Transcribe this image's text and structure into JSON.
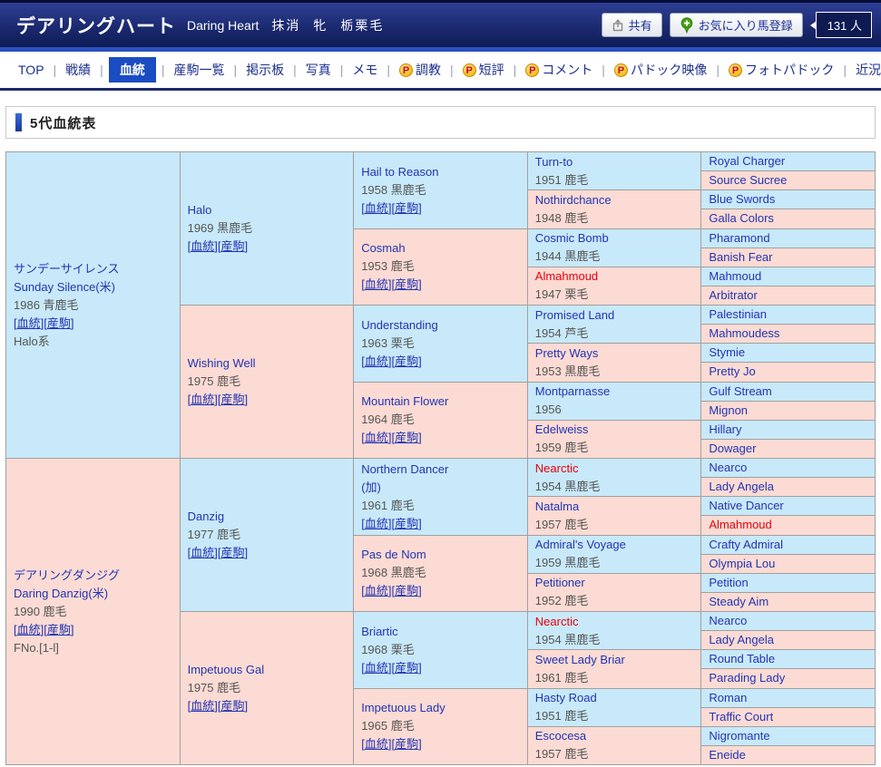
{
  "colors": {
    "male_cell_bg": "#c8e9f9",
    "female_cell_bg": "#fbdbd3",
    "link_blue": "#2333b5",
    "inbreed_red": "#e8000d",
    "header_navy": "#1b2a70",
    "selected_tab_blue": "#1a4cc2",
    "grid_border": "#a0a0a0"
  },
  "header": {
    "title_ja": "デアリングハート",
    "title_en": "Daring Heart",
    "status": "抹消",
    "sex": "牝",
    "coat": "栃栗毛",
    "share_label": "共有",
    "favorite_label": "お気に入り馬登録",
    "fans_count": "131 人"
  },
  "nav": {
    "items": [
      {
        "label": "TOP",
        "selected": false,
        "premium": false
      },
      {
        "label": "戦績",
        "selected": false,
        "premium": false
      },
      {
        "label": "血統",
        "selected": true,
        "premium": false
      },
      {
        "label": "産駒一覧",
        "selected": false,
        "premium": false
      },
      {
        "label": "掲示板",
        "selected": false,
        "premium": false
      },
      {
        "label": "写真",
        "selected": false,
        "premium": false
      },
      {
        "label": "メモ",
        "selected": false,
        "premium": false
      },
      {
        "label": "調教",
        "selected": false,
        "premium": true
      },
      {
        "label": "短評",
        "selected": false,
        "premium": true
      },
      {
        "label": "コメント",
        "selected": false,
        "premium": true
      },
      {
        "label": "パドック映像",
        "selected": false,
        "premium": true
      },
      {
        "label": "フォトパドック",
        "selected": false,
        "premium": true
      },
      {
        "label": "近況",
        "selected": false,
        "premium": false
      }
    ]
  },
  "section": {
    "title": "5代血統表"
  },
  "pedigree": {
    "link_labels": {
      "blood": "血統",
      "offspring": "産駒"
    },
    "gen1": [
      {
        "name": "サンデーサイレンス",
        "name_en": "Sunday Silence(米)",
        "year_coat": "1986 青鹿毛",
        "links": true,
        "extra": "Halo系",
        "sex": "m"
      },
      {
        "name": "デアリングダンジグ",
        "name_en": "Daring Danzig(米)",
        "year_coat": "1990 鹿毛",
        "links": true,
        "extra": "FNo.[1-l]",
        "sex": "f"
      }
    ],
    "gen2": [
      {
        "name": "Halo",
        "year_coat": "1969 黒鹿毛",
        "links": true,
        "sex": "m"
      },
      {
        "name": "Wishing Well",
        "year_coat": "1975 鹿毛",
        "links": true,
        "sex": "f"
      },
      {
        "name": "Danzig",
        "year_coat": "1977 鹿毛",
        "links": true,
        "sex": "m"
      },
      {
        "name": "Impetuous Gal",
        "year_coat": "1975 鹿毛",
        "links": true,
        "sex": "f"
      }
    ],
    "gen3": [
      {
        "name": "Hail to Reason",
        "year_coat": "1958 黒鹿毛",
        "links": true,
        "sex": "m"
      },
      {
        "name": "Cosmah",
        "year_coat": "1953 鹿毛",
        "links": true,
        "sex": "f"
      },
      {
        "name": "Understanding",
        "year_coat": "1963 栗毛",
        "links": true,
        "sex": "m"
      },
      {
        "name": "Mountain Flower",
        "year_coat": "1964 鹿毛",
        "links": true,
        "sex": "f"
      },
      {
        "name": "Northern Dancer",
        "suffix": "(加)",
        "year_coat": "1961 鹿毛",
        "links": true,
        "sex": "m"
      },
      {
        "name": "Pas de Nom",
        "year_coat": "1968 黒鹿毛",
        "links": true,
        "sex": "f"
      },
      {
        "name": "Briartic",
        "year_coat": "1968 栗毛",
        "links": true,
        "sex": "m"
      },
      {
        "name": "Impetuous Lady",
        "year_coat": "1965 鹿毛",
        "links": true,
        "sex": "f"
      }
    ],
    "gen4": [
      {
        "name": "Turn-to",
        "year_coat": "1951 鹿毛",
        "sex": "m"
      },
      {
        "name": "Nothirdchance",
        "year_coat": "1948 鹿毛",
        "sex": "f"
      },
      {
        "name": "Cosmic Bomb",
        "year_coat": "1944 黒鹿毛",
        "sex": "m"
      },
      {
        "name": "Almahmoud",
        "year_coat": "1947 栗毛",
        "sex": "f",
        "red": true
      },
      {
        "name": "Promised Land",
        "year_coat": "1954 芦毛",
        "sex": "m"
      },
      {
        "name": "Pretty Ways",
        "year_coat": "1953 黒鹿毛",
        "sex": "f"
      },
      {
        "name": "Montparnasse",
        "year_coat": "1956",
        "sex": "m"
      },
      {
        "name": "Edelweiss",
        "year_coat": "1959 鹿毛",
        "sex": "f"
      },
      {
        "name": "Nearctic",
        "year_coat": "1954 黒鹿毛",
        "sex": "m",
        "red": true
      },
      {
        "name": "Natalma",
        "year_coat": "1957 鹿毛",
        "sex": "f"
      },
      {
        "name": "Admiral's Voyage",
        "year_coat": "1959 黒鹿毛",
        "sex": "m"
      },
      {
        "name": "Petitioner",
        "year_coat": "1952 鹿毛",
        "sex": "f"
      },
      {
        "name": "Nearctic",
        "year_coat": "1954 黒鹿毛",
        "sex": "m",
        "red": true
      },
      {
        "name": "Sweet Lady Briar",
        "year_coat": "1961 鹿毛",
        "sex": "f"
      },
      {
        "name": "Hasty Road",
        "year_coat": "1951 鹿毛",
        "sex": "m"
      },
      {
        "name": "Escocesa",
        "year_coat": "1957 鹿毛",
        "sex": "f"
      }
    ],
    "gen5": [
      {
        "name": "Royal Charger",
        "sex": "m"
      },
      {
        "name": "Source Sucree",
        "sex": "f"
      },
      {
        "name": "Blue Swords",
        "sex": "m"
      },
      {
        "name": "Galla Colors",
        "sex": "f"
      },
      {
        "name": "Pharamond",
        "sex": "m"
      },
      {
        "name": "Banish Fear",
        "sex": "f"
      },
      {
        "name": "Mahmoud",
        "sex": "m"
      },
      {
        "name": "Arbitrator",
        "sex": "f"
      },
      {
        "name": "Palestinian",
        "sex": "m"
      },
      {
        "name": "Mahmoudess",
        "sex": "f"
      },
      {
        "name": "Stymie",
        "sex": "m"
      },
      {
        "name": "Pretty Jo",
        "sex": "f"
      },
      {
        "name": "Gulf Stream",
        "sex": "m"
      },
      {
        "name": "Mignon",
        "sex": "f"
      },
      {
        "name": "Hillary",
        "sex": "m"
      },
      {
        "name": "Dowager",
        "sex": "f"
      },
      {
        "name": "Nearco",
        "sex": "m"
      },
      {
        "name": "Lady Angela",
        "sex": "f"
      },
      {
        "name": "Native Dancer",
        "sex": "m"
      },
      {
        "name": "Almahmoud",
        "sex": "f",
        "red": true
      },
      {
        "name": "Crafty Admiral",
        "sex": "m"
      },
      {
        "name": "Olympia Lou",
        "sex": "f"
      },
      {
        "name": "Petition",
        "sex": "m"
      },
      {
        "name": "Steady Aim",
        "sex": "f"
      },
      {
        "name": "Nearco",
        "sex": "m"
      },
      {
        "name": "Lady Angela",
        "sex": "f"
      },
      {
        "name": "Round Table",
        "sex": "m"
      },
      {
        "name": "Parading Lady",
        "sex": "f"
      },
      {
        "name": "Roman",
        "sex": "m"
      },
      {
        "name": "Traffic Court",
        "sex": "f"
      },
      {
        "name": "Nigromante",
        "sex": "m"
      },
      {
        "name": "Eneide",
        "sex": "f"
      }
    ]
  }
}
